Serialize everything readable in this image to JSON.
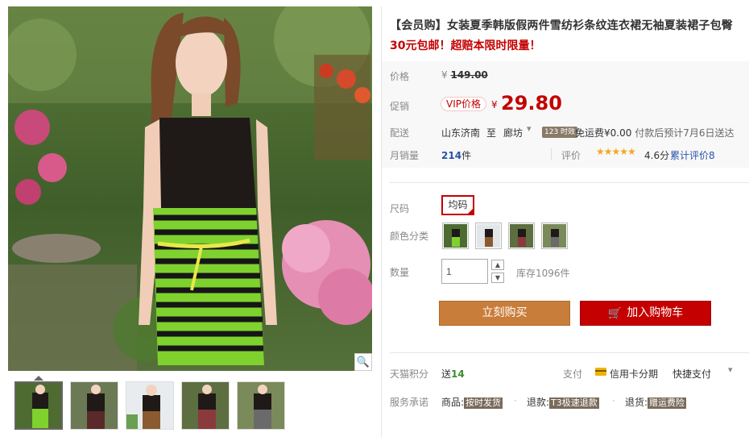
{
  "product": {
    "title": "【会员购】女装夏季韩版假两件雪纺衫条纹连衣裙无袖夏装裙子包臀",
    "subtitle": "30元包邮！超赔本限时限量！"
  },
  "price": {
    "label": "价格",
    "original": "149.00",
    "promo_label": "促销",
    "vip_tag": "VIP价格",
    "promo": "29.80",
    "currency": "¥"
  },
  "shipping": {
    "label": "配送",
    "from": "山东济南",
    "to_word": "至",
    "to": "廊坊",
    "time_tag": "123 时效",
    "fee_label": "免运费",
    "fee": "¥0.00",
    "estimate": "付款后预计7月6日送达"
  },
  "sales": {
    "label": "月销量",
    "count": "214",
    "unit": "件",
    "rating_label": "评价",
    "stars": "★★★★★",
    "score": "4.6分",
    "review_count": "累计评价8",
    "rating": 4.6
  },
  "options": {
    "size_label": "尺码",
    "size_value": "均码",
    "color_label": "颜色分类",
    "color_count": 4,
    "qty_label": "数量",
    "qty_value": "1",
    "stock": "库存1096件"
  },
  "actions": {
    "buy": "立刻购买",
    "cart": "加入购物车"
  },
  "extras": {
    "points_label": "天猫积分",
    "points_prefix": "送",
    "points": "14",
    "pay_label": "支付",
    "card": "信用卡分期",
    "quick": "快捷支付",
    "service_label": "服务承诺",
    "svc1_prefix": "商品:",
    "svc1_tag": "按时发货",
    "svc2_prefix": "退款:",
    "svc2_tag": "T3极速退款",
    "svc3_prefix": "退货:",
    "svc3_tag": "赠运费险"
  },
  "colors": {
    "price_red": "#c40000",
    "buy_orange": "#c97d3a",
    "link_blue": "#2953a6"
  }
}
